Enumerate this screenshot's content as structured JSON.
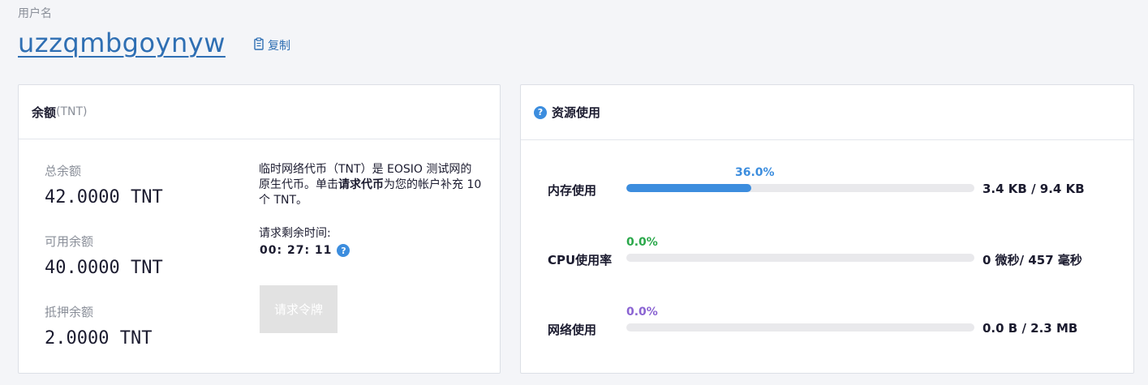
{
  "account": {
    "label": "用户名",
    "name": "uzzqmbgoynyw",
    "copy_label": "复制"
  },
  "balance": {
    "title": "余额",
    "unit": "(TNT)",
    "items": [
      {
        "label": "总余额",
        "value": "42.0000 TNT"
      },
      {
        "label": "可用余额",
        "value": "40.0000 TNT"
      },
      {
        "label": "抵押余额",
        "value": "2.0000 TNT"
      }
    ],
    "info_prefix": "临时网络代币（TNT）是 EOSIO 测试网的原生代币。单击",
    "info_bold": "请求代币",
    "info_suffix": "为您的帐户补充 10 个 TNT。",
    "timer_label": "请求剩余时间:",
    "timer_value": "00: 27: 11",
    "request_button": "请求令牌"
  },
  "resources": {
    "title": "资源使用",
    "items": [
      {
        "name": "内存使用",
        "percent_label": "36.0%",
        "percent": 36.0,
        "usage": "3.4 KB / 9.4 KB",
        "color": "#3c8dde"
      },
      {
        "name": "CPU使用率",
        "percent_label": "0.0%",
        "percent": 0.0,
        "usage": "0 微秒/ 457 毫秒",
        "color": "#2aa84a"
      },
      {
        "name": "网络使用",
        "percent_label": "0.0%",
        "percent": 0.0,
        "usage": "0.0 B / 2.3 MB",
        "color": "#8a63d2"
      }
    ]
  }
}
